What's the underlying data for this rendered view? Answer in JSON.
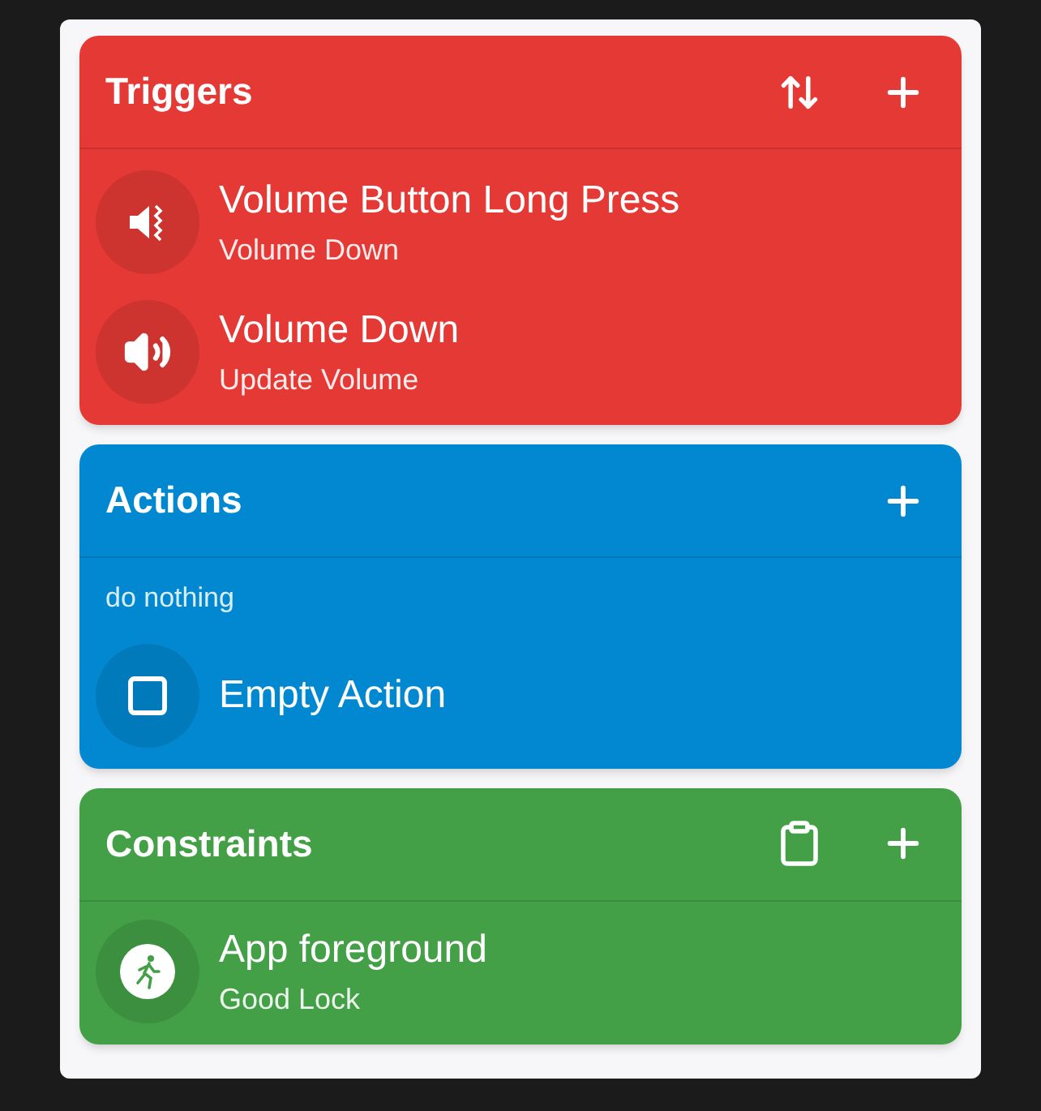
{
  "sections": [
    {
      "title": "Triggers",
      "color": "#e53935",
      "items": [
        {
          "title": "Volume Button Long Press",
          "subtitle": "Volume Down"
        },
        {
          "title": "Volume Down",
          "subtitle": "Update Volume"
        }
      ]
    },
    {
      "title": "Actions",
      "color": "#0288d1",
      "note": "do nothing",
      "items": [
        {
          "title": "Empty Action"
        }
      ]
    },
    {
      "title": "Constraints",
      "color": "#43a047",
      "items": [
        {
          "title": "App foreground",
          "subtitle": "Good Lock"
        }
      ]
    }
  ]
}
